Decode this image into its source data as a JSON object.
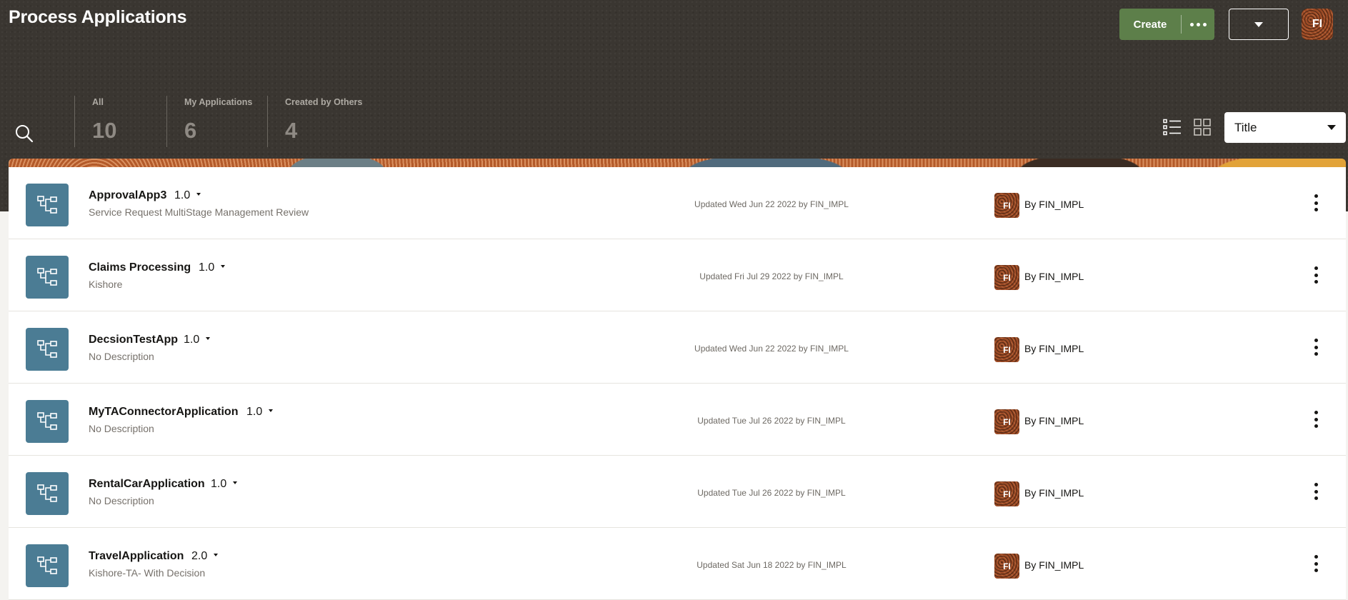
{
  "page_title": "Process Applications",
  "header": {
    "create_label": "Create",
    "user_initials": "FI"
  },
  "tabs": [
    {
      "label": "All",
      "count": "10",
      "active": false
    },
    {
      "label": "My Applications",
      "count": "6",
      "active": true
    },
    {
      "label": "Created by Others",
      "count": "4",
      "active": false
    }
  ],
  "sort": {
    "selected": "Title"
  },
  "applications": [
    {
      "name": "ApprovalApp3",
      "version": "1.0",
      "description": "Service Request MultiStage Management Review",
      "updated": "Updated Wed Jun 22 2022 by FIN_IMPL",
      "owner_initials": "FI",
      "owner": "By FIN_IMPL"
    },
    {
      "name": "Claims Processing",
      "version": "1.0",
      "description": "Kishore",
      "updated": "Updated Fri Jul 29 2022 by FIN_IMPL",
      "owner_initials": "FI",
      "owner": "By FIN_IMPL"
    },
    {
      "name": "DecsionTestApp",
      "version": "1.0",
      "description": "No Description",
      "updated": "Updated Wed Jun 22 2022 by FIN_IMPL",
      "owner_initials": "FI",
      "owner": "By FIN_IMPL"
    },
    {
      "name": "MyTAConnectorApplication",
      "version": "1.0",
      "description": "No Description",
      "updated": "Updated Tue Jul 26 2022 by FIN_IMPL",
      "owner_initials": "FI",
      "owner": "By FIN_IMPL"
    },
    {
      "name": "RentalCarApplication",
      "version": "1.0",
      "description": "No Description",
      "updated": "Updated Tue Jul 26 2022 by FIN_IMPL",
      "owner_initials": "FI",
      "owner": "By FIN_IMPL"
    },
    {
      "name": "TravelApplication",
      "version": "2.0",
      "description": "Kishore-TA- With Decision",
      "updated": "Updated Sat Jun 18 2022 by FIN_IMPL",
      "owner_initials": "FI",
      "owner": "By FIN_IMPL"
    }
  ],
  "colors": {
    "header_bg": "#3a3631",
    "create_button": "#5d7f4a",
    "active_tab_border": "#7fa264",
    "app_icon_bg": "#4b7c94"
  },
  "icons": {
    "search": "search-icon",
    "list_view": "list-view-icon",
    "grid_view": "grid-view-icon",
    "app": "process-flow-icon",
    "row_menu": "kebab-menu-icon"
  }
}
